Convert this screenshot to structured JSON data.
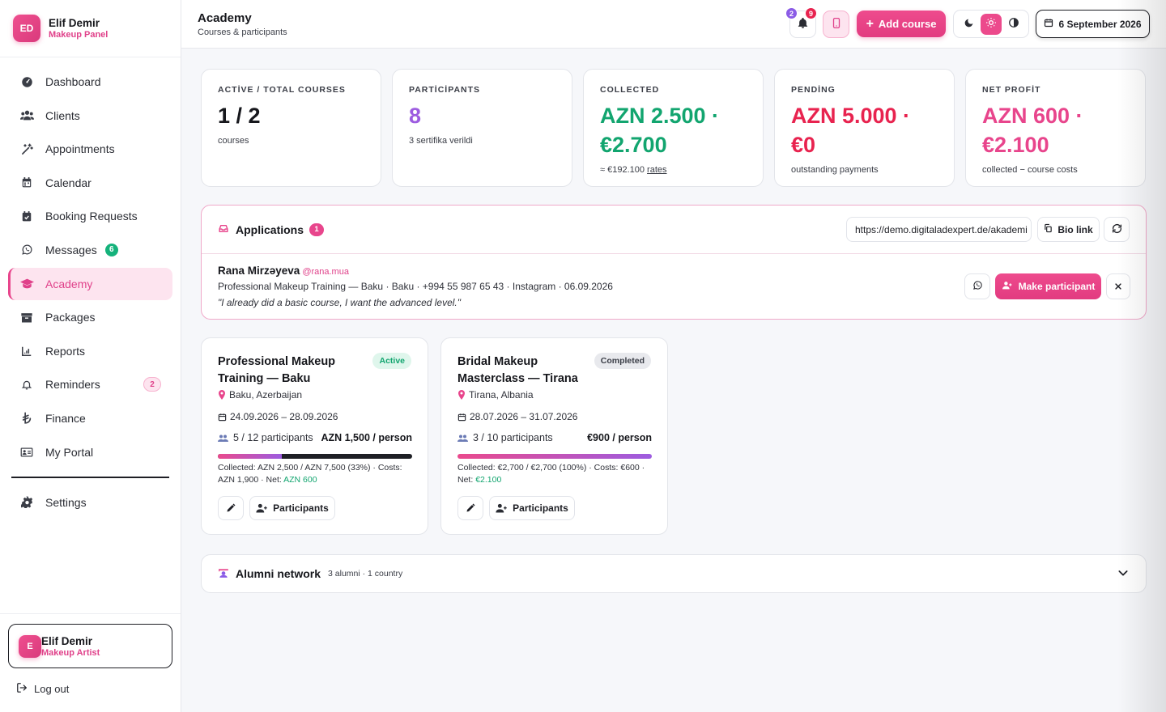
{
  "sidebar": {
    "profile": {
      "initials": "ED",
      "name": "Elif Demir",
      "role": "Makeup Panel"
    },
    "items": [
      {
        "label": "Dashboard",
        "icon": "dashboard-icon"
      },
      {
        "label": "Clients",
        "icon": "users-icon"
      },
      {
        "label": "Appointments",
        "icon": "wand-icon"
      },
      {
        "label": "Calendar",
        "icon": "calendar-icon"
      },
      {
        "label": "Booking Requests",
        "icon": "calendar-check-icon"
      },
      {
        "label": "Messages",
        "icon": "whatsapp-icon",
        "badge": "6"
      },
      {
        "label": "Academy",
        "icon": "graduation-cap-icon",
        "active": true
      },
      {
        "label": "Packages",
        "icon": "box-icon"
      },
      {
        "label": "Reports",
        "icon": "chart-icon"
      },
      {
        "label": "Reminders",
        "icon": "bell-icon",
        "badge": "2"
      },
      {
        "label": "Finance",
        "icon": "lira-icon"
      },
      {
        "label": "My Portal",
        "icon": "id-card-icon"
      }
    ],
    "settings_label": "Settings",
    "user": {
      "initials": "E",
      "name": "Elif Demir",
      "role": "Makeup Artist"
    },
    "logout_label": "Log out"
  },
  "header": {
    "title": "Academy",
    "subtitle": "Courses & participants",
    "notif_badge_a": "2",
    "notif_badge_b": "9",
    "add_course_label": "Add course",
    "date_label": "6 September 2026",
    "accent": "#e8458c"
  },
  "stats": [
    {
      "label": "ACTİVE / TOTAL COURSES",
      "value": "1 / 2",
      "note": "courses",
      "color": "#16171c"
    },
    {
      "label": "PARTİCİPANTS",
      "value": "8",
      "note": "3 sertifika verildi",
      "color": "#9d5ce0"
    },
    {
      "label": "COLLECTED",
      "value": "AZN 2.500 · €2.700",
      "note": "≈ €192.100",
      "note_link": "rates",
      "color": "#12a56f"
    },
    {
      "label": "PENDİNG",
      "value": "AZN 5.000 · €0",
      "note": "outstanding payments",
      "color": "#e8234f"
    },
    {
      "label": "NET PROFİT",
      "value": "AZN 600 · €2.100",
      "note": "collected − course costs",
      "color": "#e8458c"
    }
  ],
  "applications": {
    "title": "Applications",
    "count": "1",
    "url": "https://demo.digitaladexpert.de/akademi",
    "bio_label": "Bio link",
    "row": {
      "name": "Rana Mirzəyeva",
      "handle": "@rana.mua",
      "details": "Professional Makeup Training — Baku · Baku · +994 55 987 65 43 · Instagram · 06.09.2026",
      "quote": "\"I already did a basic course, I want the advanced level.\"",
      "make_label": "Make participant"
    }
  },
  "courses": [
    {
      "title": "Professional Makeup Training — Baku",
      "status": "Active",
      "location": "Baku, Azerbaijan",
      "dates": "24.09.2026 – 28.09.2026",
      "participants": "5 / 12 participants",
      "price": "AZN 1,500 / person",
      "collected_pct": 33,
      "fin_text": "Collected: AZN 2,500 / AZN 7,500 (33%) · Costs: AZN 1,900 · Net: ",
      "net": "AZN 600",
      "participants_label": "Participants"
    },
    {
      "title": "Bridal Makeup Masterclass — Tirana",
      "status": "Completed",
      "location": "Tirana, Albania",
      "dates": "28.07.2026 – 31.07.2026",
      "participants": "3 / 10 participants",
      "price": "€900 / person",
      "collected_pct": 100,
      "fin_text": "Collected: €2,700 / €2,700 (100%) · Costs: €600 · Net: ",
      "net": "€2.100",
      "participants_label": "Participants"
    }
  ],
  "alumni": {
    "title": "Alumni network",
    "meta": "3 alumni · 1 country"
  }
}
